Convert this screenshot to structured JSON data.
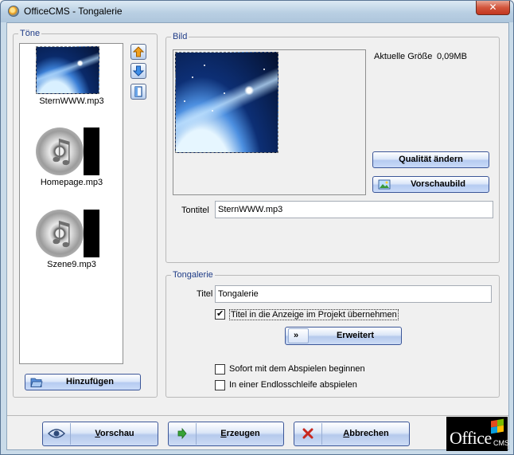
{
  "window": {
    "title": "OfficeCMS - Tongalerie",
    "close_label": "✕"
  },
  "toene": {
    "legend": "Töne",
    "items": [
      {
        "label": "SternWWW.mp3",
        "selected": true
      },
      {
        "label": "Homepage.mp3",
        "selected": false
      },
      {
        "label": "Szene9.mp3",
        "selected": false
      }
    ],
    "add_button": "Hinzufügen"
  },
  "bild": {
    "legend": "Bild",
    "size_label": "Aktuelle Größe",
    "size_value": "0,09MB",
    "quality_button": "Qualität ändern",
    "preview_button": "Vorschaubild",
    "tontitel_label": "Tontitel",
    "tontitel_value": "SternWWW.mp3"
  },
  "tongalerie": {
    "legend": "Tongalerie",
    "titel_label": "Titel",
    "titel_value": "Tongalerie",
    "take_title_label": "Titel in die Anzeige im Projekt übernehmen",
    "take_title_checked": true,
    "advanced_button": "Erweitert",
    "autoplay_label": "Sofort mit dem Abspielen beginnen",
    "autoplay_checked": false,
    "loop_label": "In einer Endlosschleife abspielen",
    "loop_checked": false
  },
  "footer": {
    "preview_button": "Vorschau",
    "generate_button": "Erzeugen",
    "cancel_button": "Abbrechen"
  },
  "logo": {
    "word": "Office",
    "sub": "CMS"
  },
  "colors": {
    "group_legend": "#1f3c87",
    "button_border": "#3b5698",
    "titlebar": "#b9cfe3",
    "close_red": "#c2361f"
  }
}
